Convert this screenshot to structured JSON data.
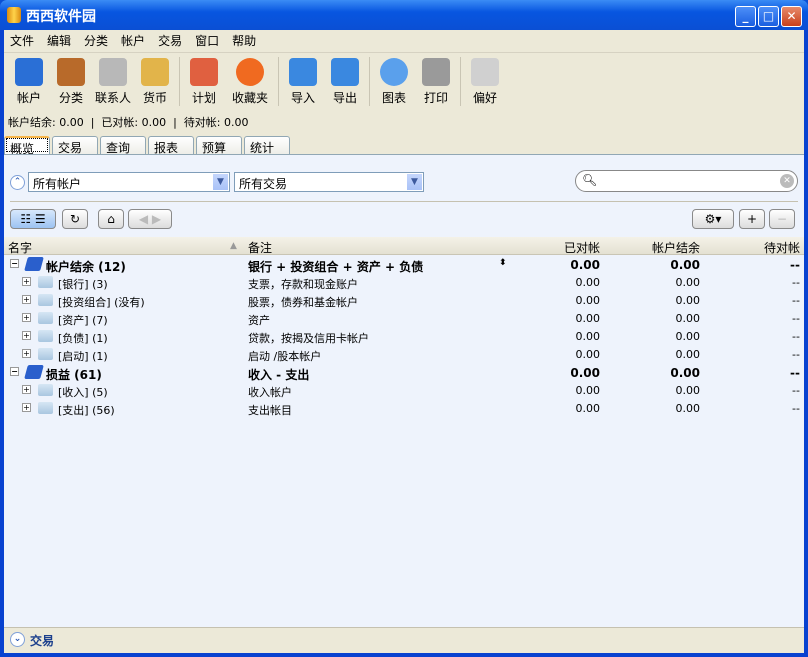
{
  "window": {
    "title": "西西软件园"
  },
  "menu": [
    "文件",
    "编辑",
    "分类",
    "帐户",
    "交易",
    "窗口",
    "帮助"
  ],
  "toolbar": [
    {
      "label": "帐户",
      "icon": "account-book-icon",
      "color": "#2a6fd6"
    },
    {
      "label": "分类",
      "icon": "cabinet-icon",
      "color": "#b86a2a"
    },
    {
      "label": "联系人",
      "icon": "contact-icon",
      "color": "#b8b8b8"
    },
    {
      "label": "货币",
      "icon": "currency-icon",
      "color": "#e2b44a"
    },
    {
      "label": "计划",
      "icon": "calendar-icon",
      "color": "#e06040"
    },
    {
      "label": "收藏夹",
      "icon": "heart-icon",
      "color": "#f06a20"
    },
    {
      "label": "导入",
      "icon": "import-icon",
      "color": "#3a88e0"
    },
    {
      "label": "导出",
      "icon": "export-icon",
      "color": "#3a88e0"
    },
    {
      "label": "图表",
      "icon": "pie-chart-icon",
      "color": "#5aa0ec"
    },
    {
      "label": "打印",
      "icon": "printer-icon",
      "color": "#9a9a9a"
    },
    {
      "label": "偏好",
      "icon": "switch-icon",
      "color": "#d0d0d0"
    }
  ],
  "status": {
    "balance": "帐户结余: 0.00",
    "cleared": "已对帐: 0.00",
    "pending": "待对帐: 0.00"
  },
  "tabs": [
    "概览",
    "交易",
    "查询",
    "报表",
    "预算",
    "统计"
  ],
  "filters": {
    "account": "所有帐户",
    "transaction": "所有交易",
    "search_placeholder": ""
  },
  "columns": [
    "名字",
    "备注",
    "已对帐",
    "帐户结余",
    "待对帐"
  ],
  "rows": [
    {
      "name": "帐户结余 (12)",
      "note": "银行 + 投资组合 + 资产 + 负债",
      "cleared": "0.00",
      "balance": "0.00",
      "pending": "--",
      "level": 0
    },
    {
      "name": "[银行] (3)",
      "note": "支票，存款和现金账户",
      "cleared": "0.00",
      "balance": "0.00",
      "pending": "--",
      "level": 1
    },
    {
      "name": "[投资组合] (没有)",
      "note": "股票，债券和基金帐户",
      "cleared": "0.00",
      "balance": "0.00",
      "pending": "--",
      "level": 1
    },
    {
      "name": "[资产] (7)",
      "note": "资产",
      "cleared": "0.00",
      "balance": "0.00",
      "pending": "--",
      "level": 1
    },
    {
      "name": "[负债] (1)",
      "note": "贷款，按揭及信用卡帐户",
      "cleared": "0.00",
      "balance": "0.00",
      "pending": "--",
      "level": 1
    },
    {
      "name": "[启动] (1)",
      "note": "启动 /股本帐户",
      "cleared": "0.00",
      "balance": "0.00",
      "pending": "--",
      "level": 1
    },
    {
      "name": "损益 (61)",
      "note": "收入 - 支出",
      "cleared": "0.00",
      "balance": "0.00",
      "pending": "--",
      "level": 0
    },
    {
      "name": "[收入] (5)",
      "note": "收入帐户",
      "cleared": "0.00",
      "balance": "0.00",
      "pending": "--",
      "level": 1
    },
    {
      "name": "[支出] (56)",
      "note": "支出帐目",
      "cleared": "0.00",
      "balance": "0.00",
      "pending": "--",
      "level": 1
    }
  ],
  "bottom": {
    "label": "交易"
  }
}
